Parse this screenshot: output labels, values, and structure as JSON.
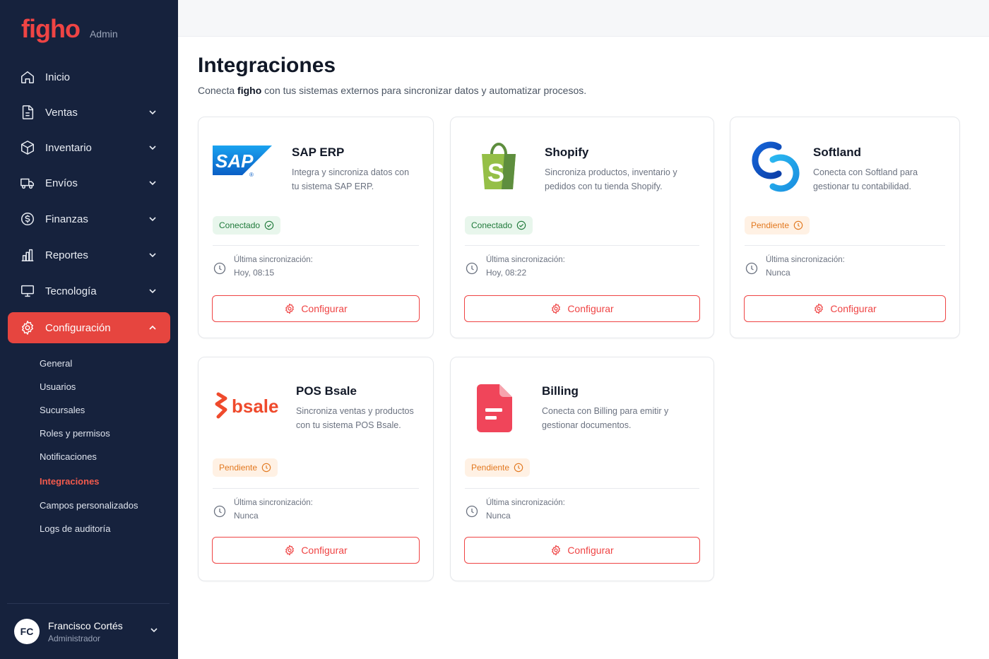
{
  "brand": {
    "name": "figho",
    "section": "Admin",
    "color": "#ef4444"
  },
  "sidebar": {
    "items": [
      {
        "label": "Inicio",
        "icon": "home-icon",
        "expandable": false
      },
      {
        "label": "Ventas",
        "icon": "document-icon",
        "expandable": true
      },
      {
        "label": "Inventario",
        "icon": "box-icon",
        "expandable": true
      },
      {
        "label": "Envíos",
        "icon": "truck-icon",
        "expandable": true
      },
      {
        "label": "Finanzas",
        "icon": "dollar-icon",
        "expandable": true
      },
      {
        "label": "Reportes",
        "icon": "bar-chart-icon",
        "expandable": true
      },
      {
        "label": "Tecnología",
        "icon": "monitor-icon",
        "expandable": true
      },
      {
        "label": "Configuración",
        "icon": "gear-icon",
        "expandable": true,
        "active": true
      }
    ],
    "subitems": [
      {
        "label": "General"
      },
      {
        "label": "Usuarios"
      },
      {
        "label": "Sucursales"
      },
      {
        "label": "Roles y permisos"
      },
      {
        "label": "Notificaciones"
      },
      {
        "label": "Integraciones",
        "active": true
      },
      {
        "label": "Campos personalizados"
      },
      {
        "label": "Logs de auditoría"
      }
    ]
  },
  "user": {
    "initials": "FC",
    "name": "Francisco Cortés",
    "role": "Administrador"
  },
  "page": {
    "title": "Integraciones",
    "subtitle_pre": "Conecta",
    "subtitle_brand": "figho",
    "subtitle_post": "con tus sistemas externos para sincronizar datos y automatizar procesos."
  },
  "sync_label": "Última sincronización:",
  "configure_label": "Configurar",
  "integrations": [
    {
      "name": "SAP ERP",
      "description": "Integra y sincroniza datos con tu sistema SAP ERP.",
      "status": "Conectado",
      "status_type": "ok",
      "last_sync": "Hoy, 08:15",
      "logo_text": "SAP"
    },
    {
      "name": "Shopify",
      "description": "Sincroniza productos, inventario y pedidos con tu tienda Shopify.",
      "status": "Conectado",
      "status_type": "ok",
      "last_sync": "Hoy, 08:22",
      "logo_text": "S"
    },
    {
      "name": "Softland",
      "description": "Conecta con Softland para gestionar tu contabilidad.",
      "status": "Pendiente",
      "status_type": "pending",
      "last_sync": "Nunca"
    },
    {
      "name": "POS Bsale",
      "description": "Sincroniza ventas y productos con tu sistema POS Bsale.",
      "status": "Pendiente",
      "status_type": "pending",
      "last_sync": "Nunca",
      "logo_text": "bsale"
    },
    {
      "name": "Billing",
      "description": "Conecta con Billing para emitir y gestionar documentos.",
      "status": "Pendiente",
      "status_type": "pending",
      "last_sync": "Nunca"
    }
  ],
  "colors": {
    "sidebar_bg": "#16223d",
    "accent": "#e6453f",
    "ok": "#1f7a3a",
    "pending": "#e2781f"
  }
}
